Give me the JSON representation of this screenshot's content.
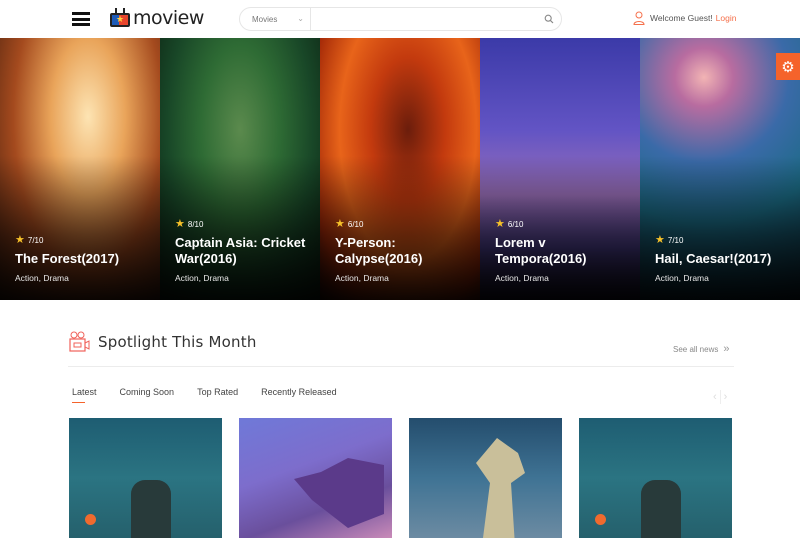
{
  "header": {
    "brand": "moview",
    "search": {
      "category": "Movies",
      "placeholder": ""
    },
    "welcome_text": "Welcome Guest!",
    "login_label": "Login"
  },
  "slider": {
    "items": [
      {
        "rating": "7/10",
        "title": "The Forest(2017)",
        "genre": "Action, Drama"
      },
      {
        "rating": "8/10",
        "title": "Captain Asia: Cricket War(2016)",
        "genre": "Action, Drama"
      },
      {
        "rating": "6/10",
        "title": "Y-Person: Calypse(2016)",
        "genre": "Action, Drama"
      },
      {
        "rating": "6/10",
        "title": "Lorem v Tempora(2016)",
        "genre": "Action, Drama"
      },
      {
        "rating": "7/10",
        "title": "Hail, Caesar!(2017)",
        "genre": "Action, Drama"
      }
    ]
  },
  "spotlight": {
    "title": "Spotlight This Month",
    "see_all": "See all news",
    "tabs": [
      {
        "label": "Latest",
        "active": true
      },
      {
        "label": "Coming Soon",
        "active": false
      },
      {
        "label": "Top Rated",
        "active": false
      },
      {
        "label": "Recently Released",
        "active": false
      }
    ]
  },
  "colors": {
    "accent": "#f5632b",
    "login": "#f5704b",
    "star": "#f6c12a"
  }
}
